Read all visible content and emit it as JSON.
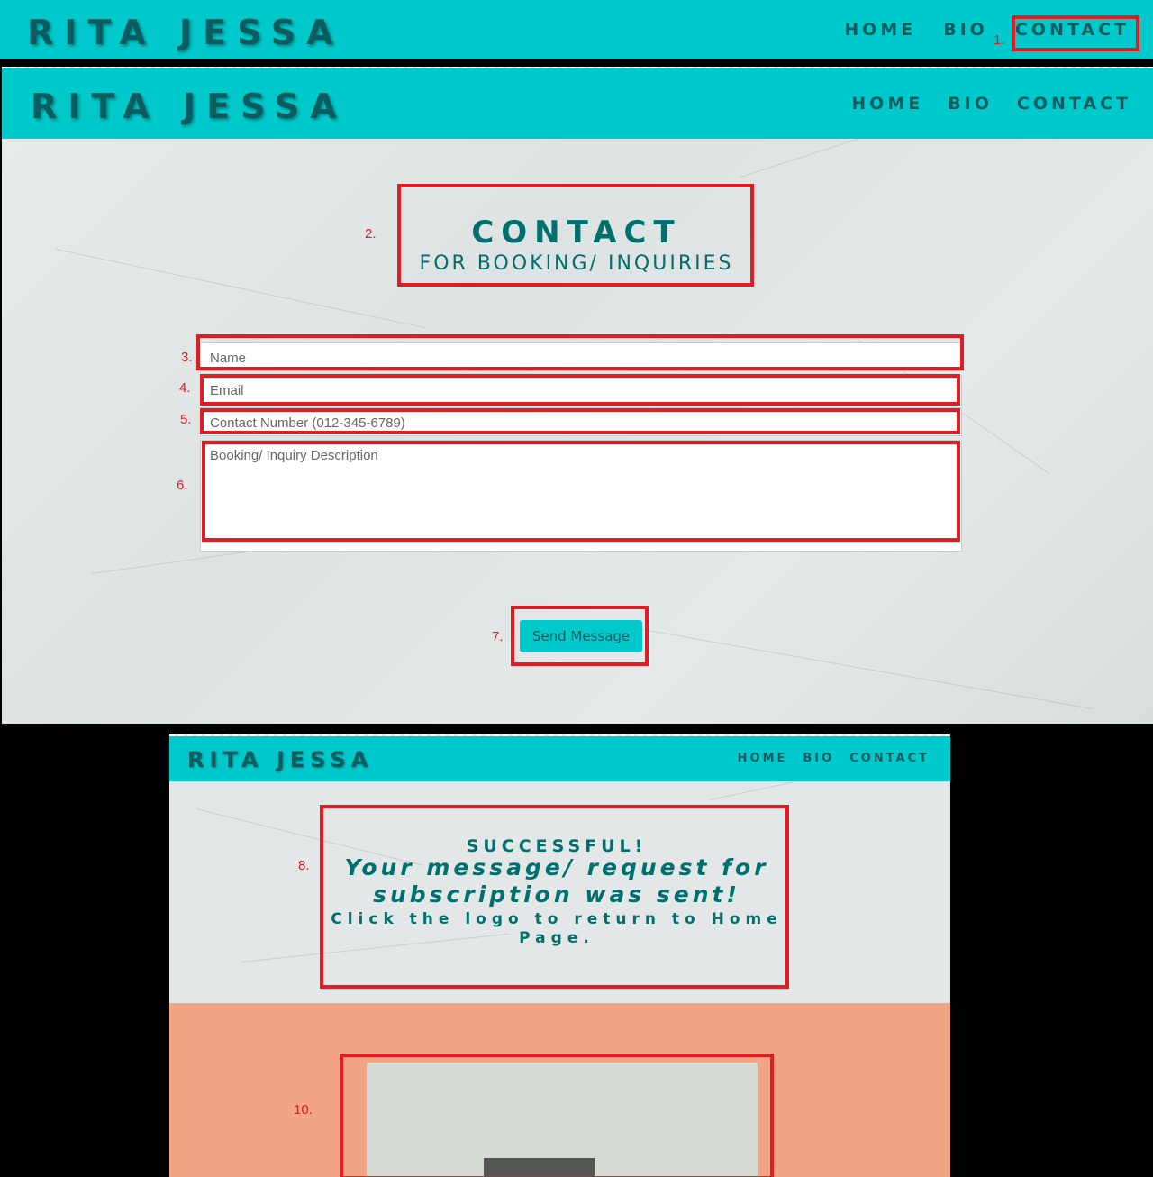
{
  "site": {
    "logo": "RITA JESSA",
    "nav": [
      "HOME",
      "BIO",
      "CONTACT"
    ]
  },
  "annotations": [
    "1.",
    "2.",
    "3.",
    "4.",
    "5.",
    "6.",
    "7.",
    "8.",
    "10."
  ],
  "contact": {
    "title": "CONTACT",
    "subtitle": "FOR BOOKING/ INQUIRIES",
    "name_placeholder": "Name",
    "email_placeholder": "Email",
    "phone_placeholder": "Contact Number (012-345-6789)",
    "description_placeholder": "Booking/ Inquiry Description",
    "send_label": "Send Message"
  },
  "success": {
    "heading": "SUCCESSFUL!",
    "message": "Your message/ request for subscription was sent!",
    "instruction": "Click the logo to return to Home Page."
  },
  "colors": {
    "accent": "#00c9cc",
    "text_dark": "#0a5c5e",
    "highlight": "#e31b23",
    "section_bg": "#f1a584"
  }
}
